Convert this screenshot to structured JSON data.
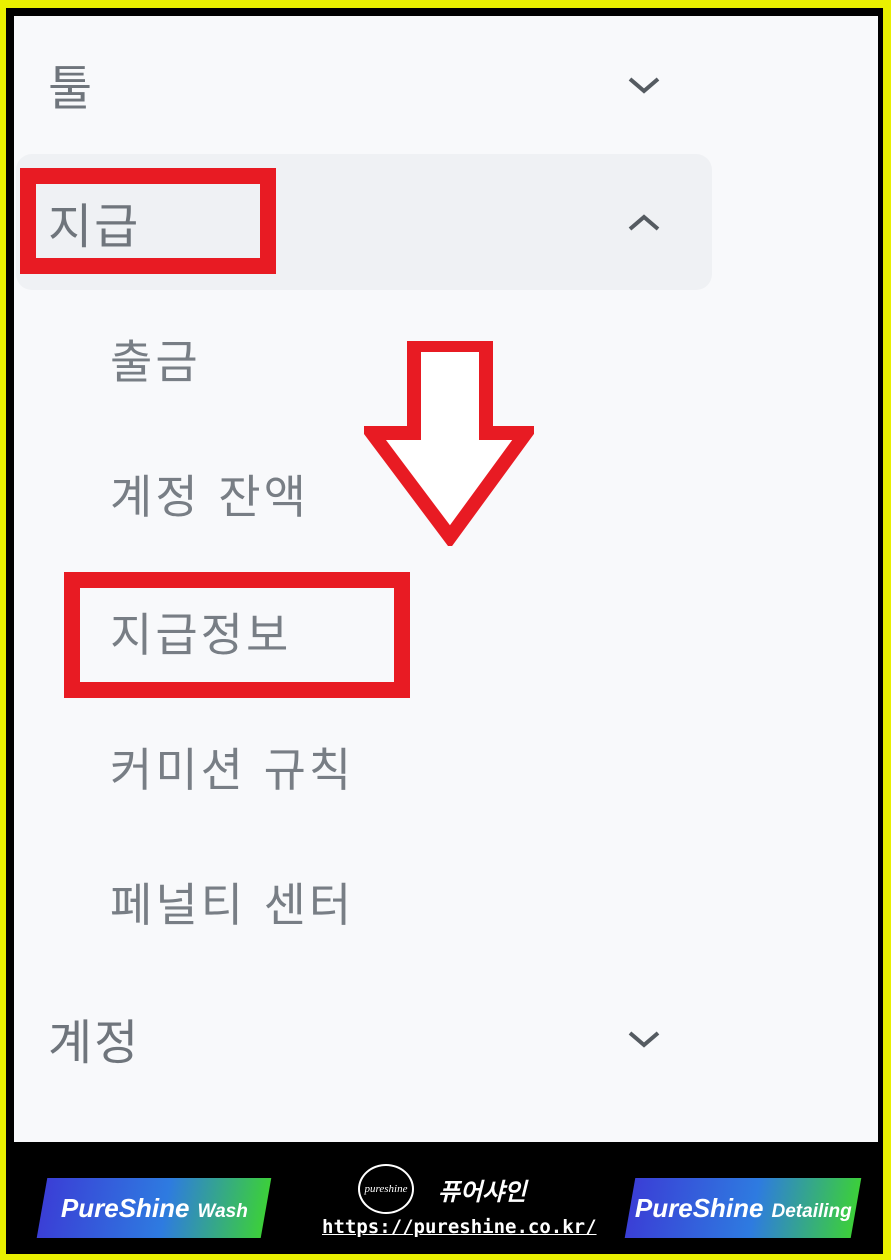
{
  "menu": {
    "tools": {
      "label": "툴",
      "expanded": false
    },
    "payment": {
      "label": "지급",
      "expanded": true,
      "sub_items": [
        "출금",
        "계정 잔액",
        "지급정보",
        "커미션 규칙",
        "페널티 센터"
      ],
      "highlighted_sub_item": "지급정보"
    },
    "account": {
      "label": "계정",
      "expanded": false
    }
  },
  "footer": {
    "left_badge": {
      "main": "PureShine",
      "sub": "Wash"
    },
    "logo_text": "pureshine",
    "brand_korean": "퓨어샤인",
    "url": "https://pureshine.co.kr/",
    "right_badge": {
      "main": "PureShine",
      "sub": "Detailing"
    }
  },
  "colors": {
    "frame": "#e9f000",
    "highlight_red": "#e81b23",
    "panel_bg": "#f8f9fb",
    "text_gray": "#6f757c"
  },
  "icons": {
    "collapsed": "chevron-down-icon",
    "expanded": "chevron-up-icon",
    "annotation": "down-arrow-outline-icon"
  }
}
